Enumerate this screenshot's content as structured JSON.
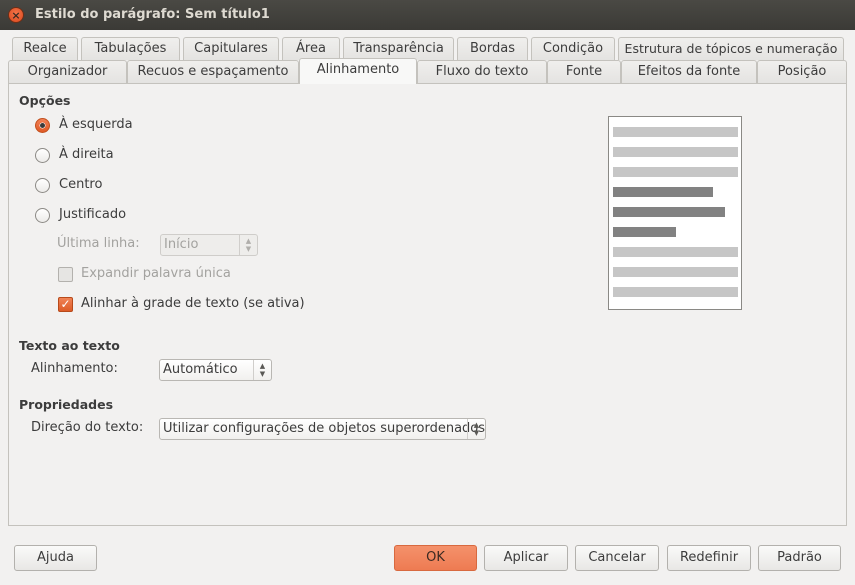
{
  "window": {
    "title": "Estilo do parágrafo: Sem título1"
  },
  "tabs_row1": [
    "Realce",
    "Tabulações",
    "Capitulares",
    "Área",
    "Transparência",
    "Bordas",
    "Condição",
    "Estrutura de tópicos e numeração"
  ],
  "tabs_row2": [
    "Organizador",
    "Recuos e espaçamento",
    "Alinhamento",
    "Fluxo do texto",
    "Fonte",
    "Efeitos da fonte",
    "Posição"
  ],
  "active_tab": "Alinhamento",
  "options": {
    "heading": "Opções",
    "left": "À esquerda",
    "right": "À direita",
    "center": "Centro",
    "justified": "Justificado",
    "last_line_label": "Última linha:",
    "last_line_value": "Início",
    "expand_single_word": "Expandir palavra única",
    "snap_to_grid": "Alinhar à grade de texto (se ativa)"
  },
  "text_to_text": {
    "heading": "Texto ao texto",
    "alignment_label": "Alinhamento:",
    "alignment_value": "Automático"
  },
  "properties": {
    "heading": "Propriedades",
    "direction_label": "Direção do texto:",
    "direction_value": "Utilizar configurações de objetos superordenados"
  },
  "buttons": {
    "help": "Ajuda",
    "ok": "OK",
    "apply": "Aplicar",
    "cancel": "Cancelar",
    "reset": "Redefinir",
    "default": "Padrão"
  }
}
